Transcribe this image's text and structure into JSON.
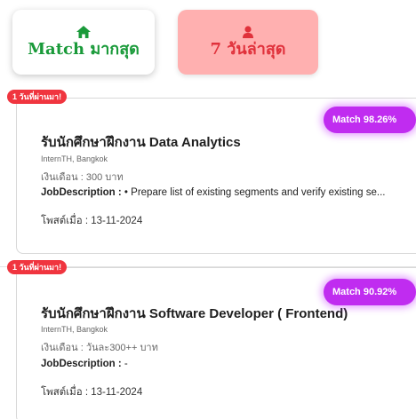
{
  "tabs": {
    "match": {
      "label": "Match มากสุด",
      "icon": "home-icon",
      "color": "#1a9a3a"
    },
    "recent": {
      "label": "7 วันล่าสุด",
      "icon": "user-icon",
      "color": "#e0313b"
    }
  },
  "jobs": [
    {
      "age_badge": "1 วันที่ผ่านมา!",
      "match": "Match 98.26%",
      "title": "รับนักศึกษาฝึกงาน Data Analytics",
      "company": "InternTH, Bangkok",
      "salary": "เงินเดือน : 300 บาท",
      "description_label": "JobDescription :",
      "description": " • Prepare list of existing segments and verify existing se...",
      "posted": "โพสต์เมื่อ : 13-11-2024"
    },
    {
      "age_badge": "1 วันที่ผ่านมา!",
      "match": "Match 90.92%",
      "title": "รับนักศึกษาฝึกงาน Software Developer ( Frontend)",
      "company": "InternTH, Bangkok",
      "salary": "เงินเดือน : วันละ300++ บาท",
      "description_label": "JobDescription :",
      "description": " -",
      "posted": "โพสต์เมื่อ : 13-11-2024"
    }
  ],
  "colors": {
    "match_pill": "#c02cf0",
    "age_badge": "#f0353f",
    "recent_tab_bg": "#ffb0b0"
  }
}
